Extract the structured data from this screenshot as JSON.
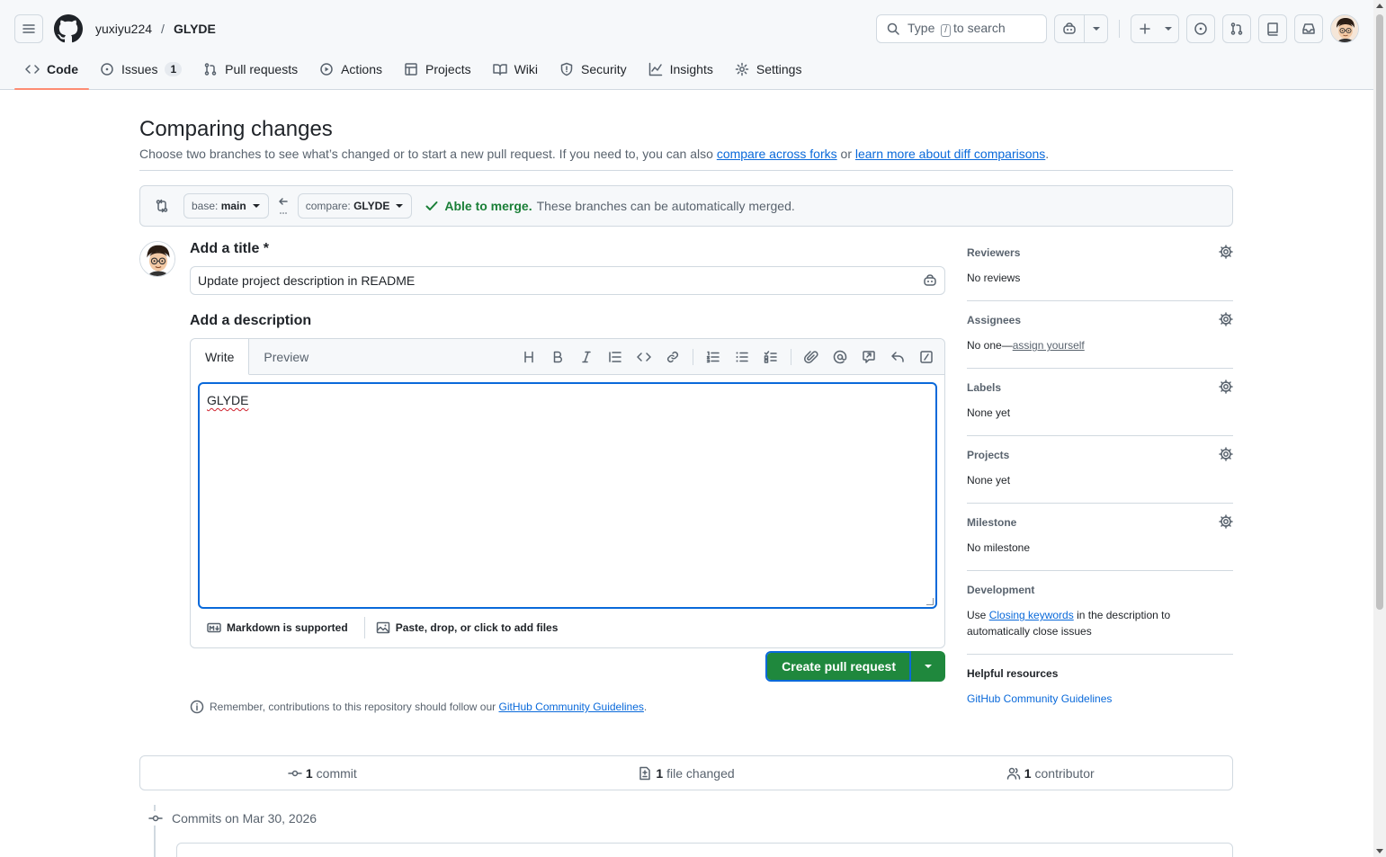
{
  "header": {
    "owner": "yuxiyu224",
    "separator": "/",
    "repo": "GLYDE",
    "search_prefix": "Type",
    "search_key": "/",
    "search_suffix": "to search",
    "icons": [
      "hamburger-icon",
      "github-logo-icon",
      "search-icon",
      "copilot-icon",
      "plus-icon",
      "issues-icon",
      "pull-request-icon",
      "repo-icon",
      "inbox-icon"
    ]
  },
  "tabs": [
    {
      "label": "Code",
      "icon": "code-icon",
      "active": true
    },
    {
      "label": "Issues",
      "icon": "issue-icon",
      "count": "1"
    },
    {
      "label": "Pull requests",
      "icon": "pull-request-icon"
    },
    {
      "label": "Actions",
      "icon": "play-icon"
    },
    {
      "label": "Projects",
      "icon": "table-icon"
    },
    {
      "label": "Wiki",
      "icon": "book-icon"
    },
    {
      "label": "Security",
      "icon": "shield-icon"
    },
    {
      "label": "Insights",
      "icon": "graph-icon"
    },
    {
      "label": "Settings",
      "icon": "gear-icon"
    }
  ],
  "page": {
    "title": "Comparing changes",
    "subtitle_pre": "Choose two branches to see what’s changed or to start a new pull request. If you need to, you can also ",
    "link_forks": "compare across forks",
    "subtitle_mid": " or ",
    "link_learn": "learn more about diff comparisons",
    "subtitle_end": "."
  },
  "range": {
    "base_label": "base:",
    "base_value": "main",
    "compare_label": "compare:",
    "compare_value": "GLYDE",
    "merge_status": "Able to merge.",
    "merge_msg": "These branches can be automatically merged.",
    "status_color": "#1a7f37"
  },
  "form": {
    "title_label": "Add a title *",
    "title_value": "Update project description in README",
    "desc_label": "Add a description",
    "tab_write": "Write",
    "tab_preview": "Preview",
    "desc_value": "GLYDE",
    "markdown_note": "Markdown is supported",
    "files_note": "Paste, drop, or click to add files",
    "toolbar_icons": [
      "heading-icon",
      "bold-icon",
      "italic-icon",
      "quote-icon",
      "code-icon",
      "link-icon",
      "ordered-list-icon",
      "unordered-list-icon",
      "task-list-icon",
      "attach-icon",
      "mention-icon",
      "reference-icon",
      "reply-icon",
      "slash-command-icon"
    ],
    "create_label": "Create pull request",
    "create_color": "#1f883d",
    "note_pre": "Remember, contributions to this repository should follow our ",
    "note_link": "GitHub Community Guidelines",
    "note_end": "."
  },
  "sidebar": {
    "reviewers_h": "Reviewers",
    "reviewers_v": "No reviews",
    "assignees_h": "Assignees",
    "assignees_pre": "No one—",
    "assignees_link": "assign yourself",
    "labels_h": "Labels",
    "labels_v": "None yet",
    "projects_h": "Projects",
    "projects_v": "None yet",
    "milestone_h": "Milestone",
    "milestone_v": "No milestone",
    "dev_h": "Development",
    "dev_pre": "Use ",
    "dev_link": "Closing keywords",
    "dev_post": " in the description to automatically close issues",
    "help_h": "Helpful resources",
    "help_link": "GitHub Community Guidelines"
  },
  "stats": {
    "commits_n": "1",
    "commits_l": "commit",
    "files_n": "1",
    "files_l": "file changed",
    "contrib_n": "1",
    "contrib_l": "contributor"
  },
  "commits": {
    "heading": "Commits on Mar 30, 2026"
  }
}
